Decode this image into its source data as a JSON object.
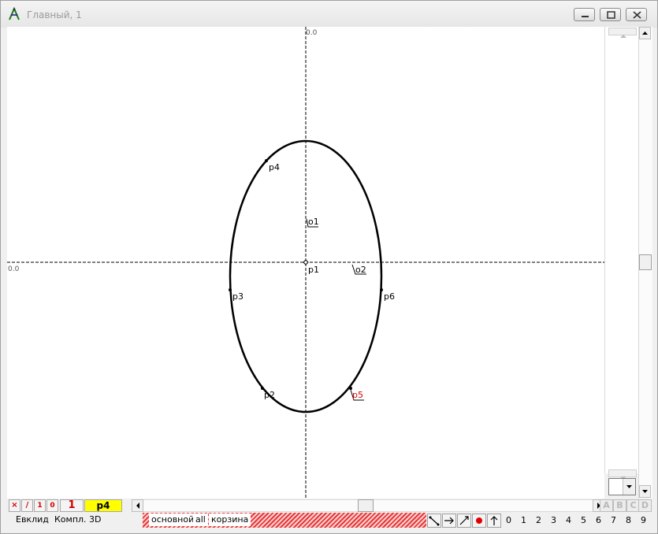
{
  "window": {
    "title": "Главный, 1",
    "icon": "app-compass-icon"
  },
  "canvas": {
    "origin_x_label": "0.0",
    "origin_y_label": "0.0",
    "points": [
      {
        "id": "p1",
        "label": "p1"
      },
      {
        "id": "p2",
        "label": "p2"
      },
      {
        "id": "p3",
        "label": "p3"
      },
      {
        "id": "p4",
        "label": "p4"
      },
      {
        "id": "p5",
        "label": "p5"
      },
      {
        "id": "p6",
        "label": "p6"
      }
    ],
    "objects": [
      {
        "id": "o1",
        "label": "o1"
      },
      {
        "id": "o2",
        "label": "o2"
      }
    ],
    "colors": {
      "curve": "#000000",
      "highlight": "#d40000",
      "axis": "#000000"
    }
  },
  "toolbar": {
    "delete_label": "×",
    "line_label": "/",
    "one_small_label": "1",
    "zero_small_label": "0",
    "counter_value": "1",
    "selected_object": "p4",
    "selected_bg": "#ffff00",
    "letters": [
      "A",
      "B",
      "C",
      "D"
    ]
  },
  "tabs": {
    "geometry": [
      "Евклид",
      "Компл.",
      "3D"
    ],
    "layers": [
      "основной",
      "all",
      "корзина"
    ]
  },
  "tools": [
    "segment-tool-icon",
    "arrow-right-tool-icon",
    "diagonal-line-tool-icon",
    "red-dot-tool-icon",
    "arrow-up-tool-icon"
  ],
  "digits": [
    "0",
    "1",
    "2",
    "3",
    "4",
    "5",
    "6",
    "7",
    "8",
    "9"
  ]
}
